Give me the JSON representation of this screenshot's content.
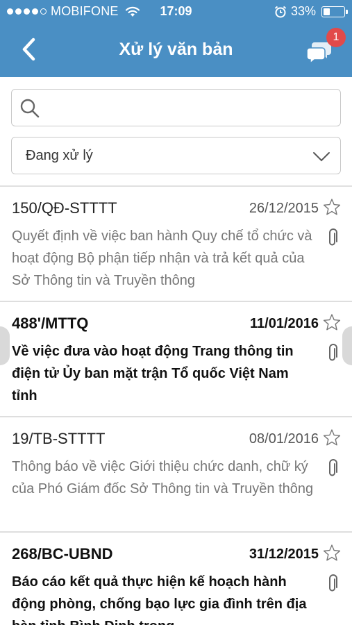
{
  "status_bar": {
    "signal_dots": 5,
    "signal_filled": 4,
    "carrier": "MOBIFONE",
    "time": "17:09",
    "battery_percent_text": "33%",
    "battery_level": 0.33
  },
  "nav": {
    "title": "Xử lý văn bản",
    "notification_count": "1",
    "icons": {
      "back": "chevron-left-icon",
      "chat": "chat-bubbles-icon"
    }
  },
  "search": {
    "value": "",
    "placeholder": ""
  },
  "filter": {
    "selected": "Đang xử lý"
  },
  "documents": [
    {
      "code": "150/QĐ-STTTT",
      "date": "26/12/2015",
      "description": "Quyết định về việc ban hành Quy chế tổ chức và hoạt động Bộ phận tiếp nhận và trả kết quả của Sở Thông tin và Truyền thông",
      "unread": false
    },
    {
      "code": "488'/MTTQ",
      "date": "11/01/2016",
      "description": "Về việc đưa vào hoạt động Trang thông tin điện tử Ủy ban mặt trận Tổ quốc Việt Nam tỉnh",
      "unread": true
    },
    {
      "code": "19/TB-STTTT",
      "date": "08/01/2016",
      "description": "Thông báo về việc Giới thiệu chức danh, chữ ký của Phó Giám đốc Sở Thông tin và Truyền thông",
      "unread": false
    },
    {
      "code": "268/BC-UBND",
      "date": "31/12/2015",
      "description": "Báo cáo kết quả thực hiện kế hoạch hành động phòng, chống bạo lực gia đình trên địa bàn tỉnh Bình Định trong",
      "unread": true
    }
  ],
  "colors": {
    "header_blue": "#4a8fc4",
    "badge_red": "#e24a4a",
    "read_text": "#777777",
    "unread_text": "#111111"
  }
}
